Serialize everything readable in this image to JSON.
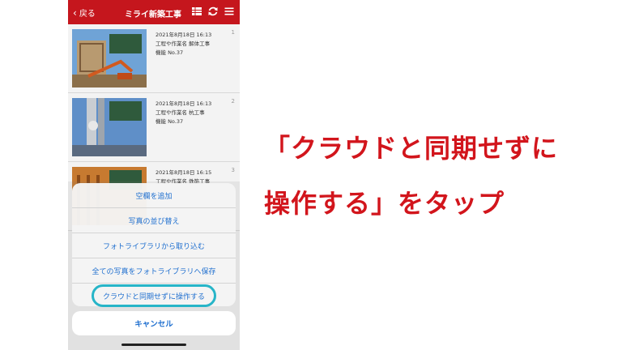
{
  "navbar": {
    "back_label": "戻る",
    "title": "ミライ新築工事",
    "icons": [
      "grid-icon",
      "sync-icon",
      "menu-icon"
    ]
  },
  "photos": [
    {
      "date": "2021年8月18日 16:13",
      "work": "工程や作業名 解体工事",
      "device": "機能 No.37",
      "index": "1"
    },
    {
      "date": "2021年8月18日 16:13",
      "work": "工程や作業名 杭工事",
      "device": "機能 No.37",
      "index": "2"
    },
    {
      "date": "2021年8月18日 16:15",
      "work": "工程や作業名 鉄筋工事",
      "device": "",
      "index": "3"
    }
  ],
  "action_sheet": {
    "items": [
      "空欄を追加",
      "写真の並び替え",
      "フォトライブラリから取り込む",
      "全ての写真をフォトライブラリへ保存",
      "クラウドと同期せずに操作する"
    ],
    "cancel": "キャンセル"
  },
  "caption": {
    "line1": "「クラウドと同期せずに",
    "line2": "操作する」をタップ"
  },
  "colors": {
    "navbar": "#c5161d",
    "caption": "#d2151c",
    "highlight": "#27b5c8",
    "link": "#1f6fcf"
  }
}
